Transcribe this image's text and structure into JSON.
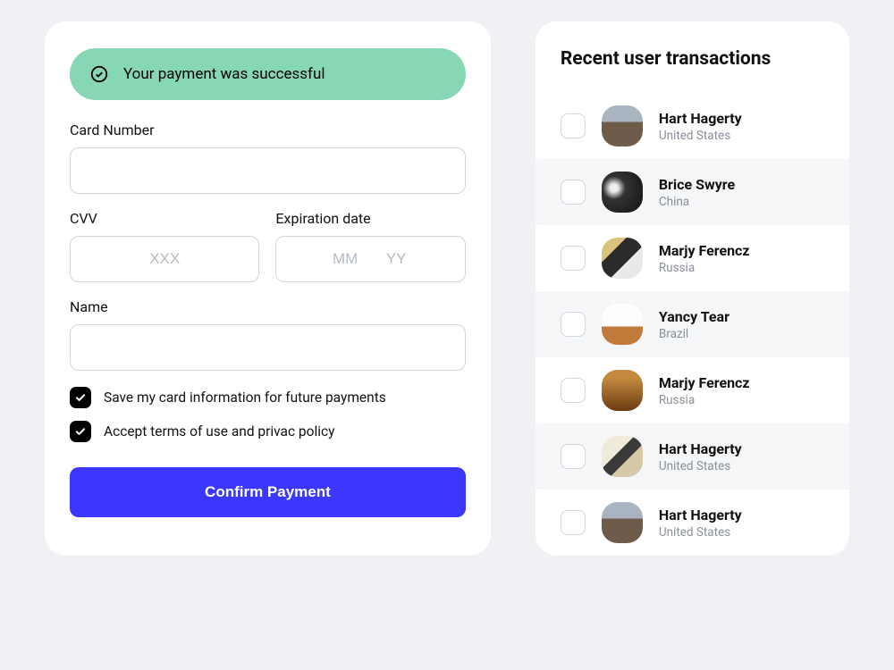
{
  "payment": {
    "alert": "Your payment was successful",
    "labels": {
      "card_number": "Card Number",
      "cvv": "CVV",
      "expiration": "Expiration date",
      "name": "Name"
    },
    "placeholders": {
      "cvv": "XXX",
      "mm": "MM",
      "yy": "YY"
    },
    "checkboxes": {
      "save_info": "Save my card information for future payments",
      "terms": "Accept terms of use and privac policy"
    },
    "confirm_button": "Confirm Payment"
  },
  "transactions": {
    "title": "Recent user transactions",
    "items": [
      {
        "name": "Hart Hagerty",
        "country": "United States"
      },
      {
        "name": "Brice Swyre",
        "country": "China"
      },
      {
        "name": "Marjy Ferencz",
        "country": "Russia"
      },
      {
        "name": "Yancy Tear",
        "country": "Brazil"
      },
      {
        "name": "Marjy Ferencz",
        "country": "Russia"
      },
      {
        "name": "Hart Hagerty",
        "country": "United States"
      },
      {
        "name": "Hart Hagerty",
        "country": "United States"
      }
    ]
  }
}
